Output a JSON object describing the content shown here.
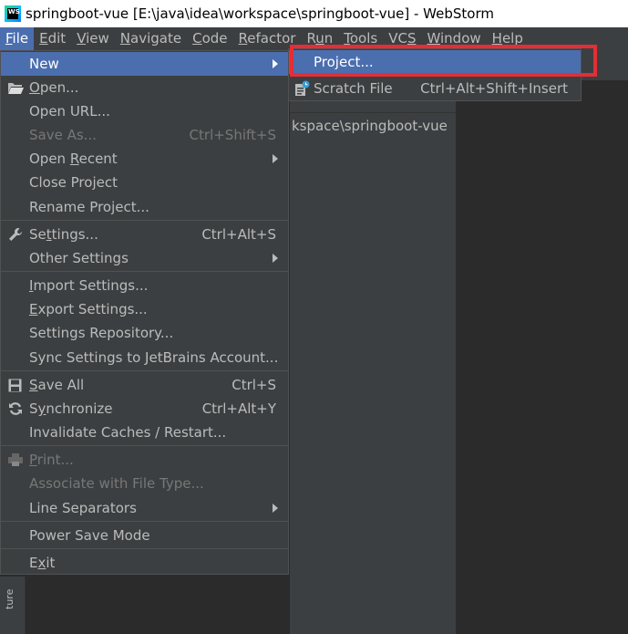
{
  "window": {
    "title": "springboot-vue [E:\\java\\idea\\workspace\\springboot-vue] - WebStorm",
    "logo_text": "WS"
  },
  "menubar": {
    "items": [
      {
        "pre": "",
        "mn": "F",
        "post": "ile"
      },
      {
        "pre": "",
        "mn": "E",
        "post": "dit"
      },
      {
        "pre": "",
        "mn": "V",
        "post": "iew"
      },
      {
        "pre": "",
        "mn": "N",
        "post": "avigate"
      },
      {
        "pre": "",
        "mn": "C",
        "post": "ode"
      },
      {
        "pre": "",
        "mn": "R",
        "post": "efactor"
      },
      {
        "pre": "R",
        "mn": "u",
        "post": "n"
      },
      {
        "pre": "",
        "mn": "T",
        "post": "ools"
      },
      {
        "pre": "VC",
        "mn": "S",
        "post": ""
      },
      {
        "pre": "",
        "mn": "W",
        "post": "indow"
      },
      {
        "pre": "",
        "mn": "H",
        "post": "elp"
      }
    ]
  },
  "file_menu": {
    "new": {
      "label": "New"
    },
    "open": {
      "pre": "",
      "mn": "O",
      "post": "pen..."
    },
    "open_url": {
      "label": "Open URL..."
    },
    "save_as": {
      "label": "Save As...",
      "shortcut": "Ctrl+Shift+S"
    },
    "open_recent": {
      "pre": "Open ",
      "mn": "R",
      "post": "ecent"
    },
    "close_project": {
      "pre": "Close Pro",
      "mn": "j",
      "post": "ect"
    },
    "rename_project": {
      "label": "Rename Project..."
    },
    "settings": {
      "pre": "Se",
      "mn": "t",
      "post": "tings...",
      "shortcut": "Ctrl+Alt+S"
    },
    "other_settings": {
      "label": "Other Settings"
    },
    "import_settings": {
      "pre": "",
      "mn": "I",
      "post": "mport Settings..."
    },
    "export_settings": {
      "pre": "",
      "mn": "E",
      "post": "xport Settings..."
    },
    "settings_repository": {
      "label": "Settings Repository..."
    },
    "sync_settings": {
      "label": "Sync Settings to JetBrains Account..."
    },
    "save_all": {
      "pre": "",
      "mn": "S",
      "post": "ave All",
      "shortcut": "Ctrl+S"
    },
    "synchronize": {
      "pre": "S",
      "mn": "y",
      "post": "nchronize",
      "shortcut": "Ctrl+Alt+Y"
    },
    "invalidate": {
      "label": "Invalidate Caches / Restart..."
    },
    "print": {
      "pre": "",
      "mn": "P",
      "post": "rint..."
    },
    "associate": {
      "label": "Associate with File Type..."
    },
    "line_separators": {
      "label": "Line Separators"
    },
    "power_save": {
      "label": "Power Save Mode"
    },
    "exit": {
      "pre": "E",
      "mn": "x",
      "post": "it"
    }
  },
  "new_submenu": {
    "project": {
      "label": "Project..."
    },
    "scratch": {
      "label": "Scratch File",
      "shortcut": "Ctrl+Alt+Shift+Insert"
    }
  },
  "background": {
    "project_path": "kspace\\springboot-vue",
    "structure_tab": "ture"
  },
  "colors": {
    "selection": "#4b6eaf",
    "menu_bg": "#3c3f41",
    "highlight": "#e52d35"
  }
}
